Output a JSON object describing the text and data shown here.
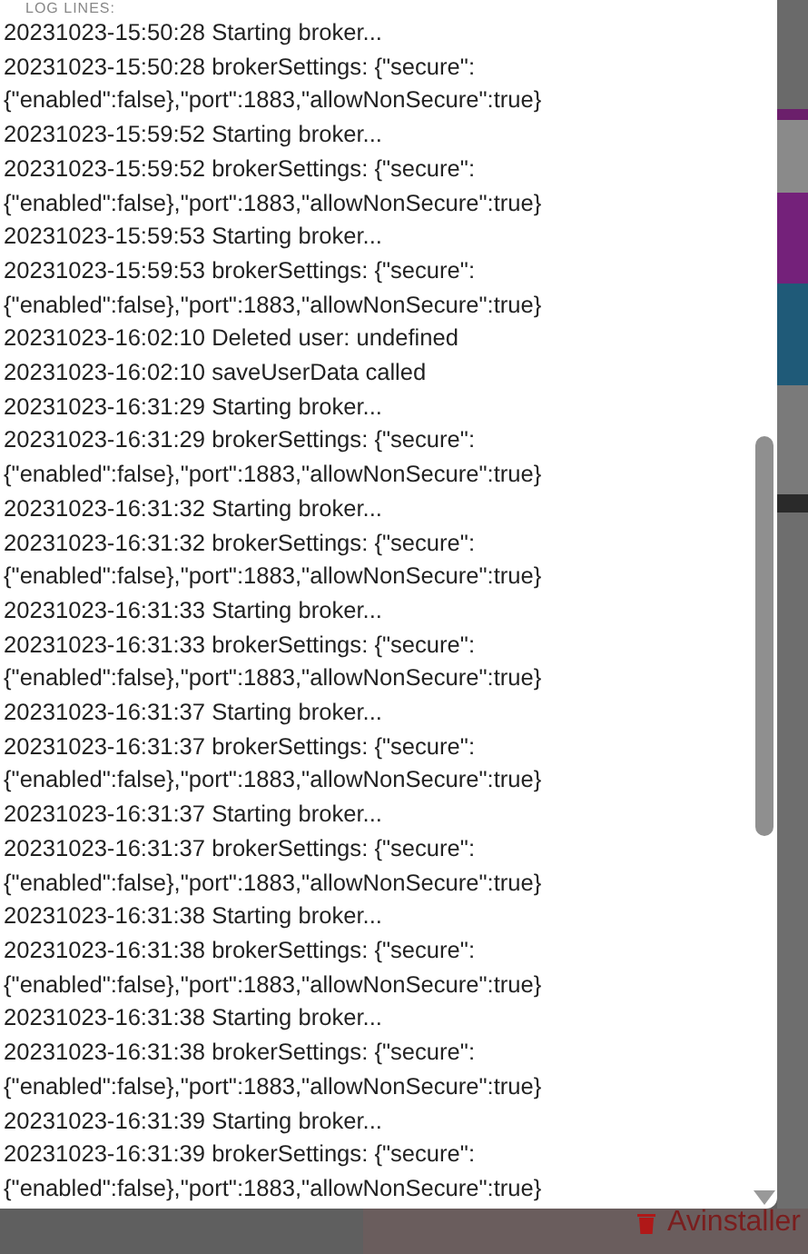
{
  "log": {
    "label": "LOG LINES:",
    "lines": [
      "20231023-15:50:28 Starting broker...",
      "20231023-15:50:28 brokerSettings: {\"secure\": {\"enabled\":false},\"port\":1883,\"allowNonSecure\":true}",
      "20231023-15:59:52 Starting broker...",
      "20231023-15:59:52 brokerSettings: {\"secure\": {\"enabled\":false},\"port\":1883,\"allowNonSecure\":true}",
      "20231023-15:59:53 Starting broker...",
      "20231023-15:59:53 brokerSettings: {\"secure\": {\"enabled\":false},\"port\":1883,\"allowNonSecure\":true}",
      "20231023-16:02:10 Deleted user: undefined",
      "20231023-16:02:10 saveUserData called",
      "20231023-16:31:29 Starting broker...",
      "20231023-16:31:29 brokerSettings: {\"secure\": {\"enabled\":false},\"port\":1883,\"allowNonSecure\":true}",
      "20231023-16:31:32 Starting broker...",
      "20231023-16:31:32 brokerSettings: {\"secure\": {\"enabled\":false},\"port\":1883,\"allowNonSecure\":true}",
      "20231023-16:31:33 Starting broker...",
      "20231023-16:31:33 brokerSettings: {\"secure\": {\"enabled\":false},\"port\":1883,\"allowNonSecure\":true}",
      "20231023-16:31:37 Starting broker...",
      "20231023-16:31:37 brokerSettings: {\"secure\": {\"enabled\":false},\"port\":1883,\"allowNonSecure\":true}",
      "20231023-16:31:37 Starting broker...",
      "20231023-16:31:37 brokerSettings: {\"secure\": {\"enabled\":false},\"port\":1883,\"allowNonSecure\":true}",
      "20231023-16:31:38 Starting broker...",
      "20231023-16:31:38 brokerSettings: {\"secure\": {\"enabled\":false},\"port\":1883,\"allowNonSecure\":true}",
      "20231023-16:31:38 Starting broker...",
      "20231023-16:31:38 brokerSettings: {\"secure\": {\"enabled\":false},\"port\":1883,\"allowNonSecure\":true}",
      "20231023-16:31:39 Starting broker...",
      "20231023-16:31:39 brokerSettings: {\"secure\": {\"enabled\":false},\"port\":1883,\"allowNonSecure\":true}"
    ]
  },
  "uninstall_button": {
    "label": "Avinstaller"
  }
}
